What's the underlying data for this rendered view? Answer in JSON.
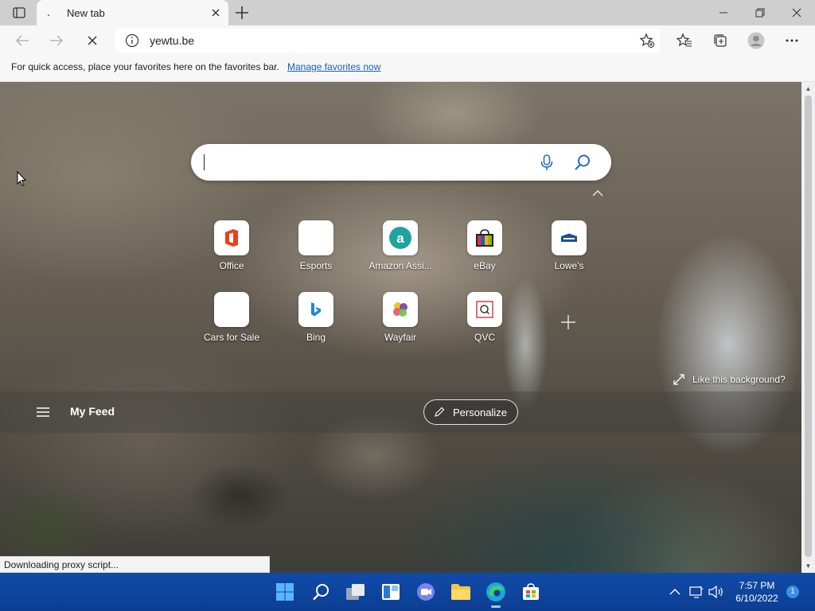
{
  "tab": {
    "title": "New tab",
    "favicon": "."
  },
  "address": {
    "url": "yewtu.be"
  },
  "favbar": {
    "message": "For quick access, place your favorites here on the favorites bar.",
    "link": "Manage favorites now"
  },
  "tiles": [
    {
      "label": "Office",
      "icon": "office-icon"
    },
    {
      "label": "Esports",
      "icon": "blank-icon"
    },
    {
      "label": "Amazon Assi...",
      "icon": "amazon-assistant-icon"
    },
    {
      "label": "eBay",
      "icon": "ebay-icon"
    },
    {
      "label": "Lowe's",
      "icon": "lowes-icon"
    },
    {
      "label": "Cars for Sale",
      "icon": "blank-icon"
    },
    {
      "label": "Bing",
      "icon": "bing-icon"
    },
    {
      "label": "Wayfair",
      "icon": "wayfair-icon"
    },
    {
      "label": "QVC",
      "icon": "qvc-icon"
    }
  ],
  "like_background": "Like this background?",
  "feed": {
    "title": "My Feed",
    "personalize": "Personalize"
  },
  "status": "Downloading proxy script...",
  "clock": {
    "time": "7:57 PM",
    "date": "6/10/2022"
  },
  "notifications": "1",
  "colors": {
    "accent": "#0c3f94",
    "link": "#1a5fb4"
  }
}
